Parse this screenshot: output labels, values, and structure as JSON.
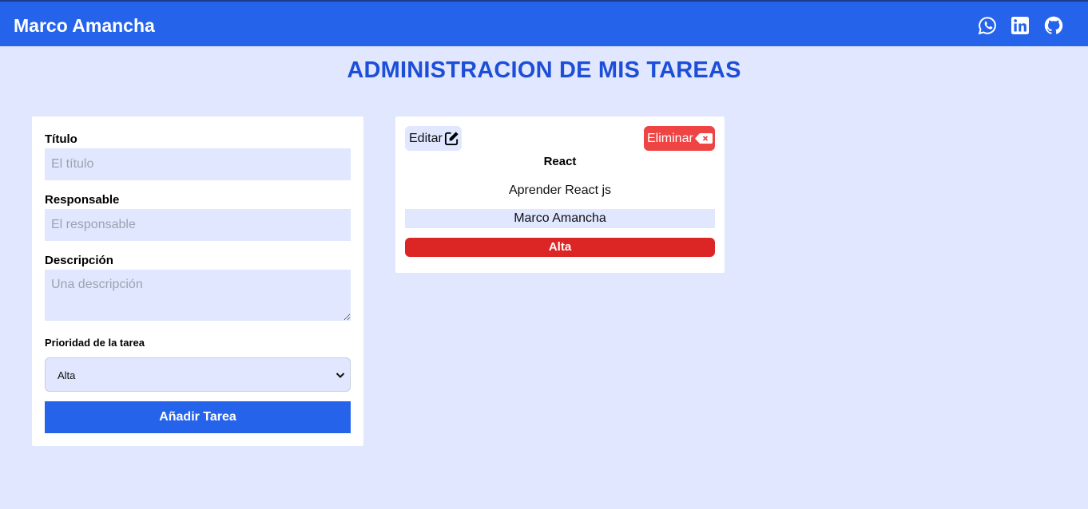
{
  "navbar": {
    "brand": "Marco Amancha",
    "icons": [
      "whatsapp-icon",
      "linkedin-icon",
      "github-icon"
    ]
  },
  "page_title": "ADMINISTRACION DE MIS TAREAS",
  "form": {
    "title_label": "Título",
    "title_placeholder": "El título",
    "title_value": "",
    "responsible_label": "Responsable",
    "responsible_placeholder": "El responsable",
    "responsible_value": "",
    "description_label": "Descripción",
    "description_placeholder": "Una descripción",
    "description_value": "",
    "priority_label": "Prioridad de la tarea",
    "priority_selected": "Alta",
    "submit_label": "Añadir Tarea"
  },
  "task_card": {
    "edit_label": "Editar",
    "delete_label": "Eliminar",
    "title": "React",
    "description": "Aprender React js",
    "responsible": "Marco Amancha",
    "priority": "Alta"
  },
  "colors": {
    "navbar": "#2563eb",
    "background": "#e0e7ff",
    "heading": "#1d4ed8",
    "delete": "#ef4444",
    "priority_high": "#dc2626"
  }
}
